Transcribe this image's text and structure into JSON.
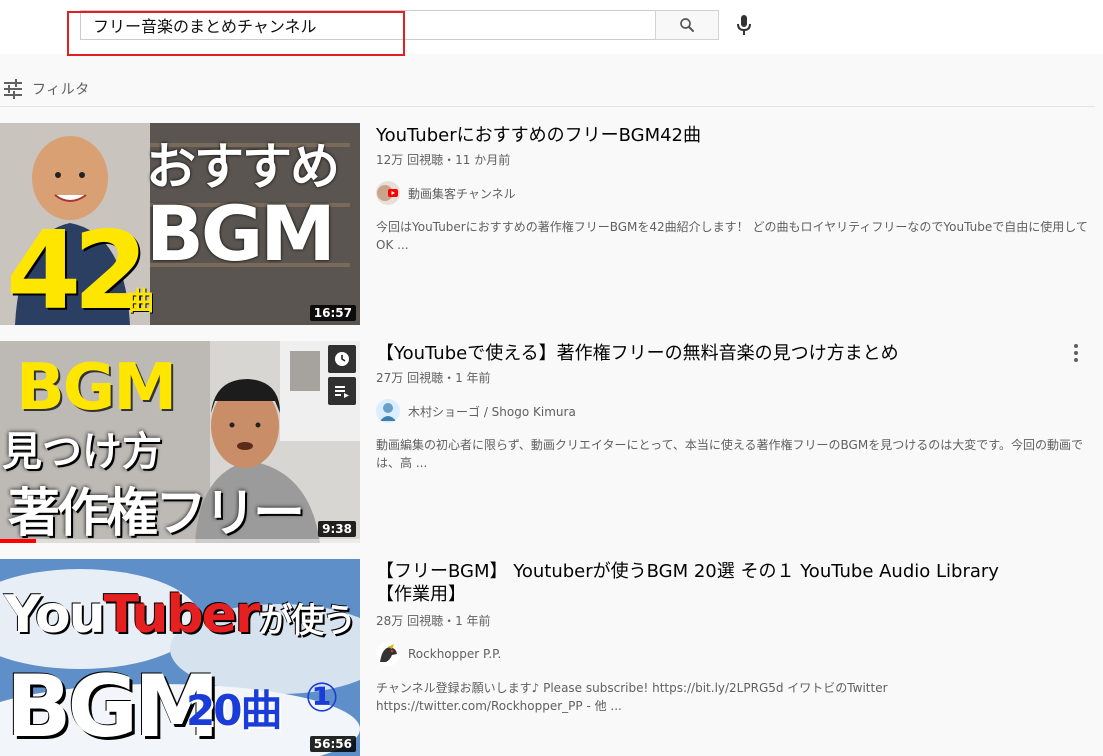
{
  "search": {
    "query": "フリー音楽のまとめチャンネル",
    "search_icon": "search-icon",
    "mic_icon": "microphone-icon"
  },
  "filter": {
    "icon": "filter-sliders-icon",
    "label": "フィルタ"
  },
  "results": [
    {
      "title": "YouTuberにおすすめのフリーBGM42曲",
      "views": "12万 回視聴",
      "age": "11 か月前",
      "channel": "動画集客チャンネル",
      "description": "今回はYouTuberにおすすめの著作権フリーBGMを42曲紹介します！ どの曲もロイヤリティフリーなのでYouTubeで自由に使用してOK ...",
      "duration": "16:57",
      "thumb_text": [
        "おすすめ",
        "BGM",
        "42",
        "曲"
      ]
    },
    {
      "title": "【YouTubeで使える】著作権フリーの無料音楽の見つけ方まとめ",
      "views": "27万 回視聴",
      "age": "1 年前",
      "channel": "木村ショーゴ / Shogo Kimura",
      "description": "動画編集の初心者に限らず、動画クリエイターにとって、本当に使える著作権フリーのBGMを見つけるのは大変です。今回の動画では、高 ...",
      "duration": "9:38",
      "watched_fraction": 0.1,
      "thumb_text": [
        "BGM",
        "見つけ方",
        "著作権フリー"
      ]
    },
    {
      "title": "【フリーBGM】 Youtuberが使うBGM 20選 その１ YouTube Audio Library 【作業用】",
      "views": "28万 回視聴",
      "age": "1 年前",
      "channel": "Rockhopper P.P.",
      "description": "チャンネル登録お願いします♪ Please subscribe! https://bit.ly/2LPRG5d イワトビのTwitter https://twitter.com/Rockhopper_PP - 他 ...",
      "duration": "56:56",
      "thumb_text": [
        "You",
        "Tuber",
        "が使う",
        "BGM",
        "20曲",
        "①"
      ]
    }
  ],
  "meta_separator": "・",
  "colors": {
    "highlight_box": "#e02020",
    "accent_yellow": "#ffe600",
    "accent_red": "#e62020",
    "accent_blue": "#1a3cd8",
    "progress_red": "#ff0000"
  }
}
